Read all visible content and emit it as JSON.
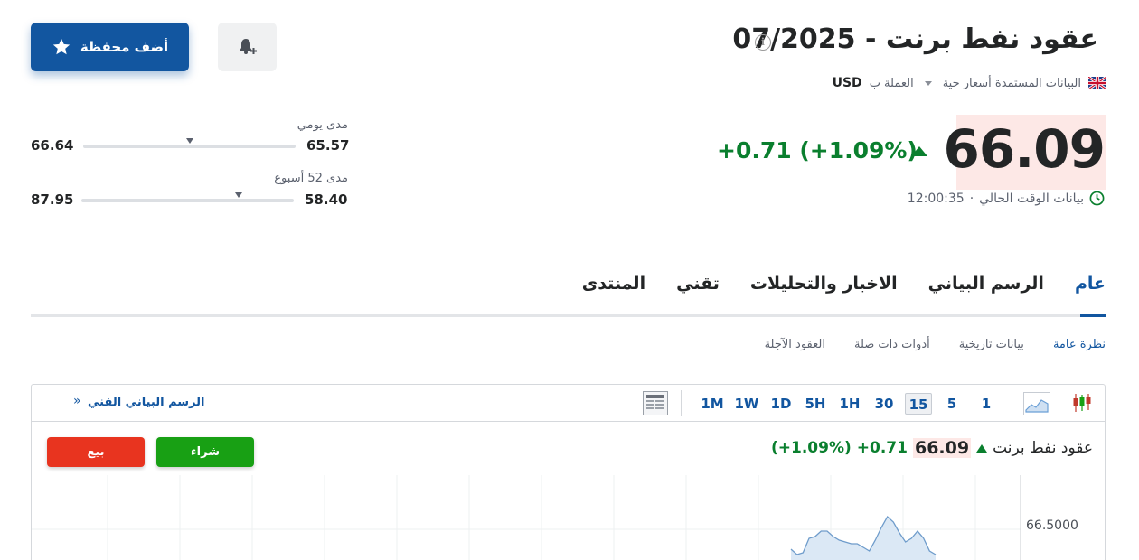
{
  "header": {
    "title": "عقود نفط برنت - 07/2025",
    "info_icon": "info-icon",
    "bell_icon": "bell-plus-icon",
    "add_portfolio_label": "أضف محفظة",
    "star_icon": "star-icon"
  },
  "subline": {
    "flag_icon": "uk-flag-icon",
    "data_source": "البيانات المستمدة أسعار حية",
    "currency_label": "العملة ب",
    "currency_value": "USD"
  },
  "quote": {
    "price": "66.09",
    "change": "+0.71 (+1.09%)",
    "direction": "up",
    "time_label": "بيانات الوقت الحالي",
    "time_value": "12:00:35",
    "clock_icon": "clock-icon",
    "colors": {
      "up": "#0a7f2e",
      "price_bg": "#fde8e6",
      "brand": "#1256a0"
    }
  },
  "ranges": {
    "daily": {
      "label": "مدى يومي",
      "low": "65.57",
      "high": "66.64",
      "position": 0.5
    },
    "week52": {
      "label": "مدى 52 أسبوع",
      "low": "58.40",
      "high": "87.95",
      "position": 0.26
    }
  },
  "tabs": [
    {
      "label": "عام",
      "active": true
    },
    {
      "label": "الرسم البياني",
      "active": false
    },
    {
      "label": "الاخبار والتحليلات",
      "active": false
    },
    {
      "label": "تقني",
      "active": false
    },
    {
      "label": "المنتدى",
      "active": false
    }
  ],
  "subtabs": [
    {
      "label": "نظرة عامة",
      "active": true
    },
    {
      "label": "بيانات تاريخية",
      "active": false
    },
    {
      "label": "أدوات ذات صلة",
      "active": false
    },
    {
      "label": "العقود الآجلة",
      "active": false
    }
  ],
  "chart_toolbar": {
    "timeframes": [
      "1",
      "5",
      "15",
      "30",
      "1H",
      "5H",
      "1D",
      "1W",
      "1M"
    ],
    "active_timeframe": "15",
    "candle_icon": "candlestick-icon",
    "area_icon": "area-chart-icon",
    "table_icon": "table-icon",
    "technical_link": "الرسم البياني الفني",
    "technical_arrow": "»"
  },
  "chart": {
    "name": "عقود نفط برنت",
    "price": "66.09",
    "change_abs": "+0.71",
    "change_pct": "(+1.09%)",
    "buy_label": "شراء",
    "sell_label": "بيع",
    "axis_label": "66.5000"
  },
  "chart_data": {
    "type": "area",
    "ylim": [
      66.2,
      66.8
    ],
    "yticks": [
      66.5
    ],
    "grid": true,
    "series": [
      {
        "values": [
          66.39,
          66.36,
          66.37,
          66.45,
          66.46,
          66.49,
          66.49,
          66.46,
          66.44,
          66.43,
          66.42,
          66.42,
          66.4,
          66.38,
          66.44,
          66.51,
          66.57,
          66.54,
          66.48,
          66.43,
          66.45,
          66.49,
          66.45,
          66.38,
          66.36
        ]
      }
    ]
  }
}
